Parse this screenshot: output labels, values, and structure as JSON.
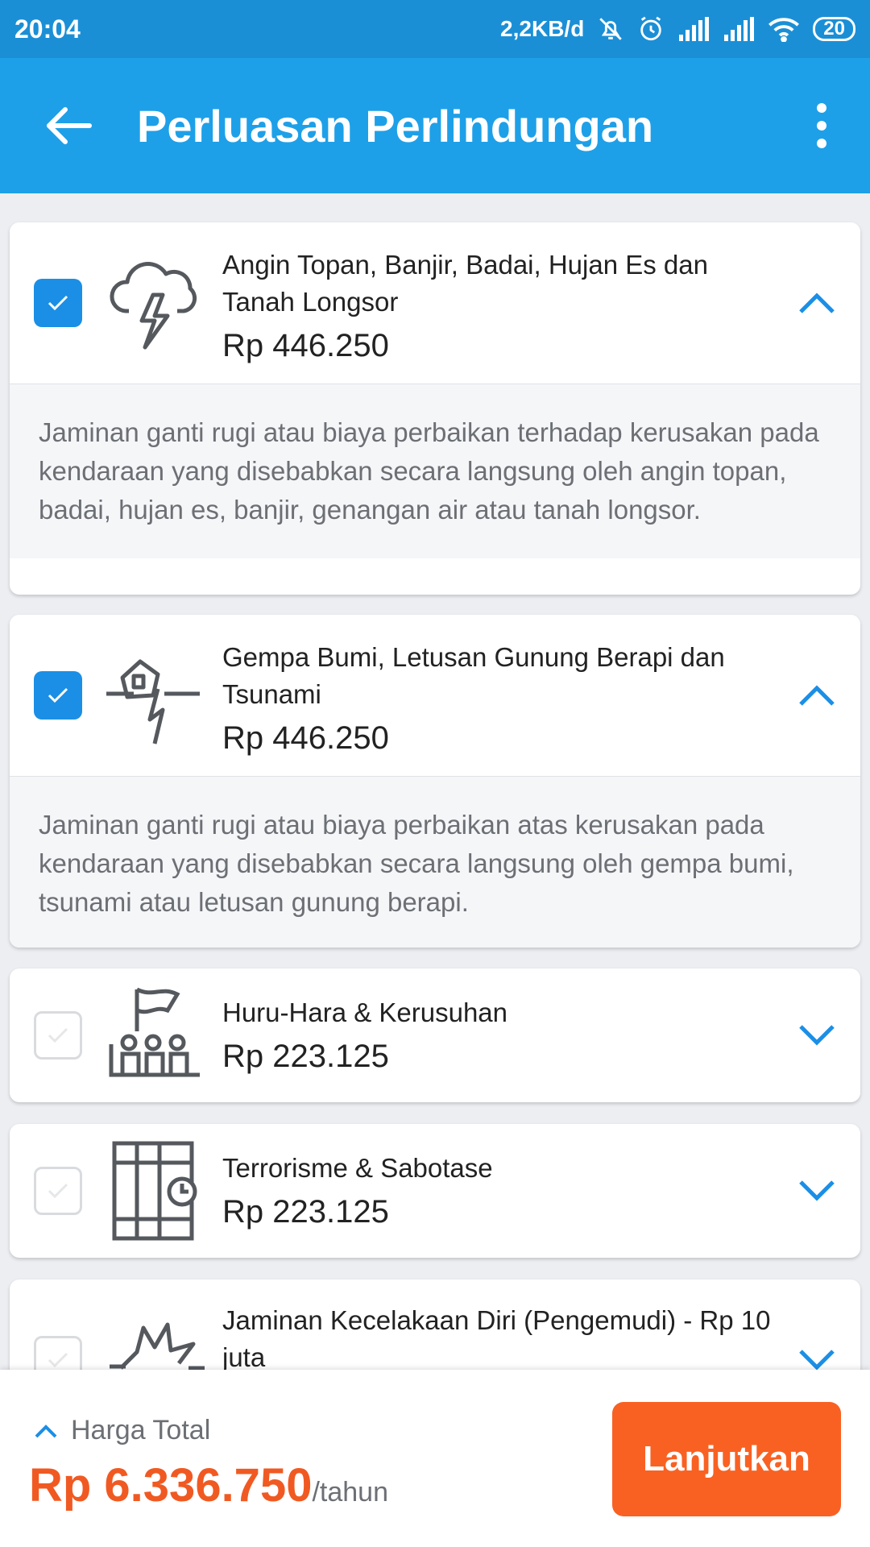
{
  "status_bar": {
    "time": "20:04",
    "network_speed": "2,2KB/d",
    "battery": "20",
    "icons": [
      "bell-off-icon",
      "alarm-icon",
      "signal-icon",
      "signal-icon",
      "wifi-icon",
      "battery-icon"
    ]
  },
  "app_bar": {
    "title": "Perluasan Perlindungan",
    "back_icon": "arrow-left-icon",
    "menu_icon": "more-vertical-icon"
  },
  "colors": {
    "primary": "#1ea0e8",
    "accent_orange": "#f96122",
    "checkbox_checked": "#1b8fe6"
  },
  "coverages": [
    {
      "name": "Angin Topan, Banjir, Badai, Hujan Es dan Tanah Longsor",
      "price": "Rp 446.250",
      "checked": true,
      "expanded": true,
      "icon": "storm-cloud-icon",
      "description": "Jaminan ganti rugi atau biaya perbaikan terhadap kerusakan pada kendaraan yang disebabkan secara langsung oleh angin topan, badai, hujan es, banjir, genangan air atau tanah longsor."
    },
    {
      "name": "Gempa Bumi, Letusan Gunung Berapi dan Tsunami",
      "price": "Rp 446.250",
      "checked": true,
      "expanded": true,
      "icon": "earthquake-icon",
      "description": "Jaminan ganti rugi atau biaya perbaikan atas kerusakan pada kendaraan yang disebabkan secara langsung oleh gempa bumi, tsunami atau letusan gunung berapi."
    },
    {
      "name": "Huru-Hara & Kerusuhan",
      "price": "Rp 223.125",
      "checked": false,
      "expanded": false,
      "icon": "riot-crowd-icon"
    },
    {
      "name": "Terrorisme & Sabotase",
      "price": "Rp 223.125",
      "checked": false,
      "expanded": false,
      "icon": "prison-bars-icon"
    },
    {
      "name": "Jaminan Kecelakaan Diri (Pengemudi) - Rp 10 juta",
      "price": "",
      "checked": false,
      "expanded": false,
      "icon": "crash-burst-icon"
    }
  ],
  "footer": {
    "total_label": "Harga Total",
    "total_value": "Rp 6.336.750",
    "per_unit": "/tahun",
    "button_label": "Lanjutkan"
  }
}
